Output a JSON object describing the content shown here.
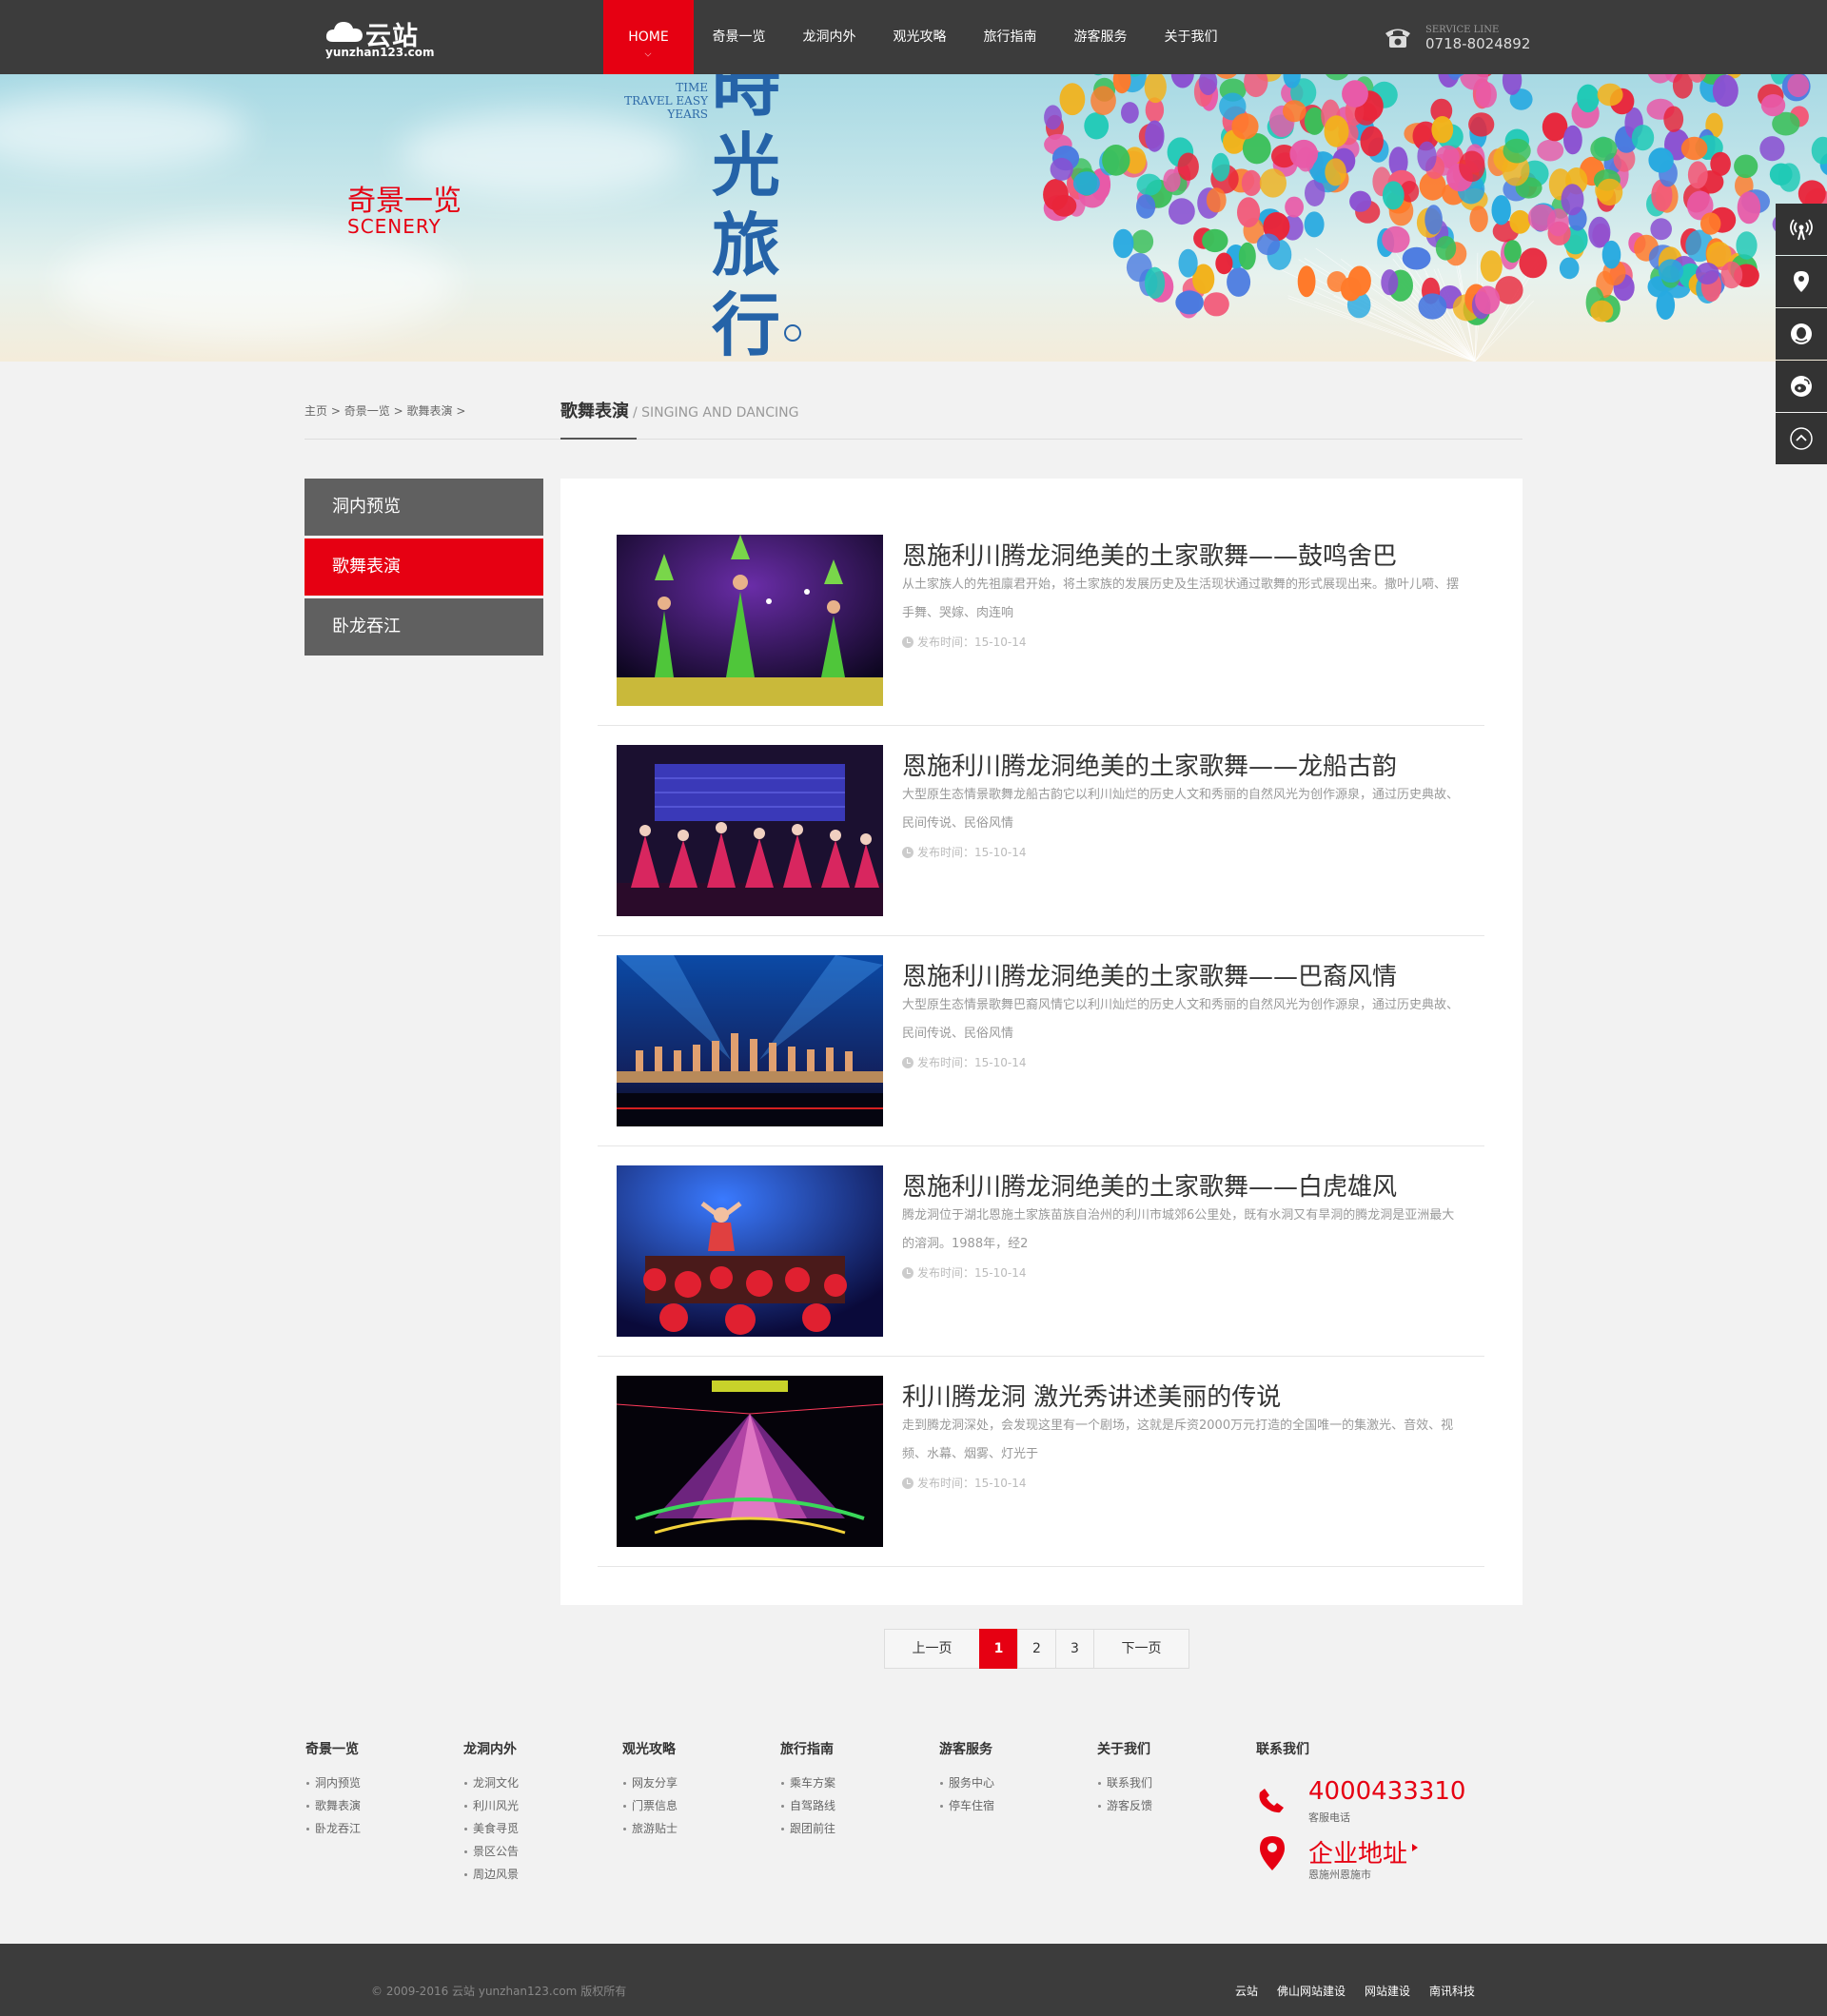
{
  "header": {
    "logo_name": "云站",
    "logo_domain": "yunzhan123.com",
    "nav": [
      {
        "label": "HOME",
        "active": true
      },
      {
        "label": "奇景一览"
      },
      {
        "label": "龙洞内外"
      },
      {
        "label": "观光攻略"
      },
      {
        "label": "旅行指南"
      },
      {
        "label": "游客服务"
      },
      {
        "label": "关于我们"
      }
    ],
    "service_label": "SERVICE LINE",
    "service_number": "0718-8024892"
  },
  "banner": {
    "title_cn": "奇景一览",
    "title_en": "SCENERY",
    "tagline_en_lines": [
      "TIME",
      "TRAVEL EASY",
      "YEARS"
    ],
    "vertical_text": "時光旅行"
  },
  "side_tools": [
    {
      "icon": "broadcast-icon"
    },
    {
      "icon": "location-icon"
    },
    {
      "icon": "qq-icon"
    },
    {
      "icon": "weibo-icon"
    },
    {
      "icon": "back-to-top-icon"
    }
  ],
  "breadcrumb": {
    "items": [
      "主页",
      "奇景一览",
      "歌舞表演"
    ],
    "separator": ">"
  },
  "section": {
    "title_cn": "歌舞表演",
    "title_en": "/ SINGING AND DANCING"
  },
  "left_menu": [
    {
      "label": "洞内预览"
    },
    {
      "label": "歌舞表演",
      "active": true
    },
    {
      "label": "卧龙吞江"
    }
  ],
  "articles": [
    {
      "title": "恩施利川腾龙洞绝美的土家歌舞——鼓鸣舍巴",
      "desc": "从土家族人的先祖廪君开始，将土家族的发展历史及生活现状通过歌舞的形式展现出来。撒叶儿嗬、摆手舞、哭嫁、肉连响",
      "date": "发布时间：15-10-14"
    },
    {
      "title": "恩施利川腾龙洞绝美的土家歌舞——龙船古韵",
      "desc": "大型原生态情景歌舞龙船古韵它以利川灿烂的历史人文和秀丽的自然风光为创作源泉，通过历史典故、民间传说、民俗风情",
      "date": "发布时间：15-10-14"
    },
    {
      "title": "恩施利川腾龙洞绝美的土家歌舞——巴裔风情",
      "desc": "大型原生态情景歌舞巴裔风情它以利川灿烂的历史人文和秀丽的自然风光为创作源泉，通过历史典故、民间传说、民俗风情",
      "date": "发布时间：15-10-14"
    },
    {
      "title": "恩施利川腾龙洞绝美的土家歌舞——白虎雄风",
      "desc": "腾龙洞位于湖北恩施土家族苗族自治州的利川市城郊6公里处，既有水洞又有旱洞的腾龙洞是亚洲最大的溶洞。1988年，经2",
      "date": "发布时间：15-10-14"
    },
    {
      "title": "利川腾龙洞 激光秀讲述美丽的传说",
      "desc": "走到腾龙洞深处，会发现这里有一个剧场，这就是斥资2000万元打造的全国唯一的集激光、音效、视频、水幕、烟雾、灯光于",
      "date": "发布时间：15-10-14"
    }
  ],
  "pagination": {
    "prev": "上一页",
    "pages": [
      "1",
      "2",
      "3"
    ],
    "current": "1",
    "next": "下一页"
  },
  "footer": {
    "columns": [
      {
        "heading": "奇景一览",
        "links": [
          "洞内预览",
          "歌舞表演",
          "卧龙吞江"
        ]
      },
      {
        "heading": "龙洞内外",
        "links": [
          "龙洞文化",
          "利川风光",
          "美食寻觅",
          "景区公告",
          "周边风景"
        ]
      },
      {
        "heading": "观光攻略",
        "links": [
          "网友分享",
          "门票信息",
          "旅游贴士"
        ]
      },
      {
        "heading": "旅行指南",
        "links": [
          "乘车方案",
          "自驾路线",
          "跟团前往"
        ]
      },
      {
        "heading": "游客服务",
        "links": [
          "服务中心",
          "停车住宿"
        ]
      },
      {
        "heading": "关于我们",
        "links": [
          "联系我们",
          "游客反馈"
        ]
      }
    ],
    "contact": {
      "heading": "联系我们",
      "phone": "4000433310",
      "phone_label": "客服电话",
      "address_title": "企业地址",
      "address": "恩施州恩施市"
    },
    "copyright": "© 2009-2016 云站 yunzhan123.com 版权所有",
    "bottom_links": [
      "云站",
      "佛山网站建设",
      "网站建设",
      "南讯科技"
    ]
  },
  "colors": {
    "accent": "#e60012",
    "header_bg": "#3c3c3c",
    "menu_bg": "#606060",
    "page_bg": "#f2f2f2"
  }
}
